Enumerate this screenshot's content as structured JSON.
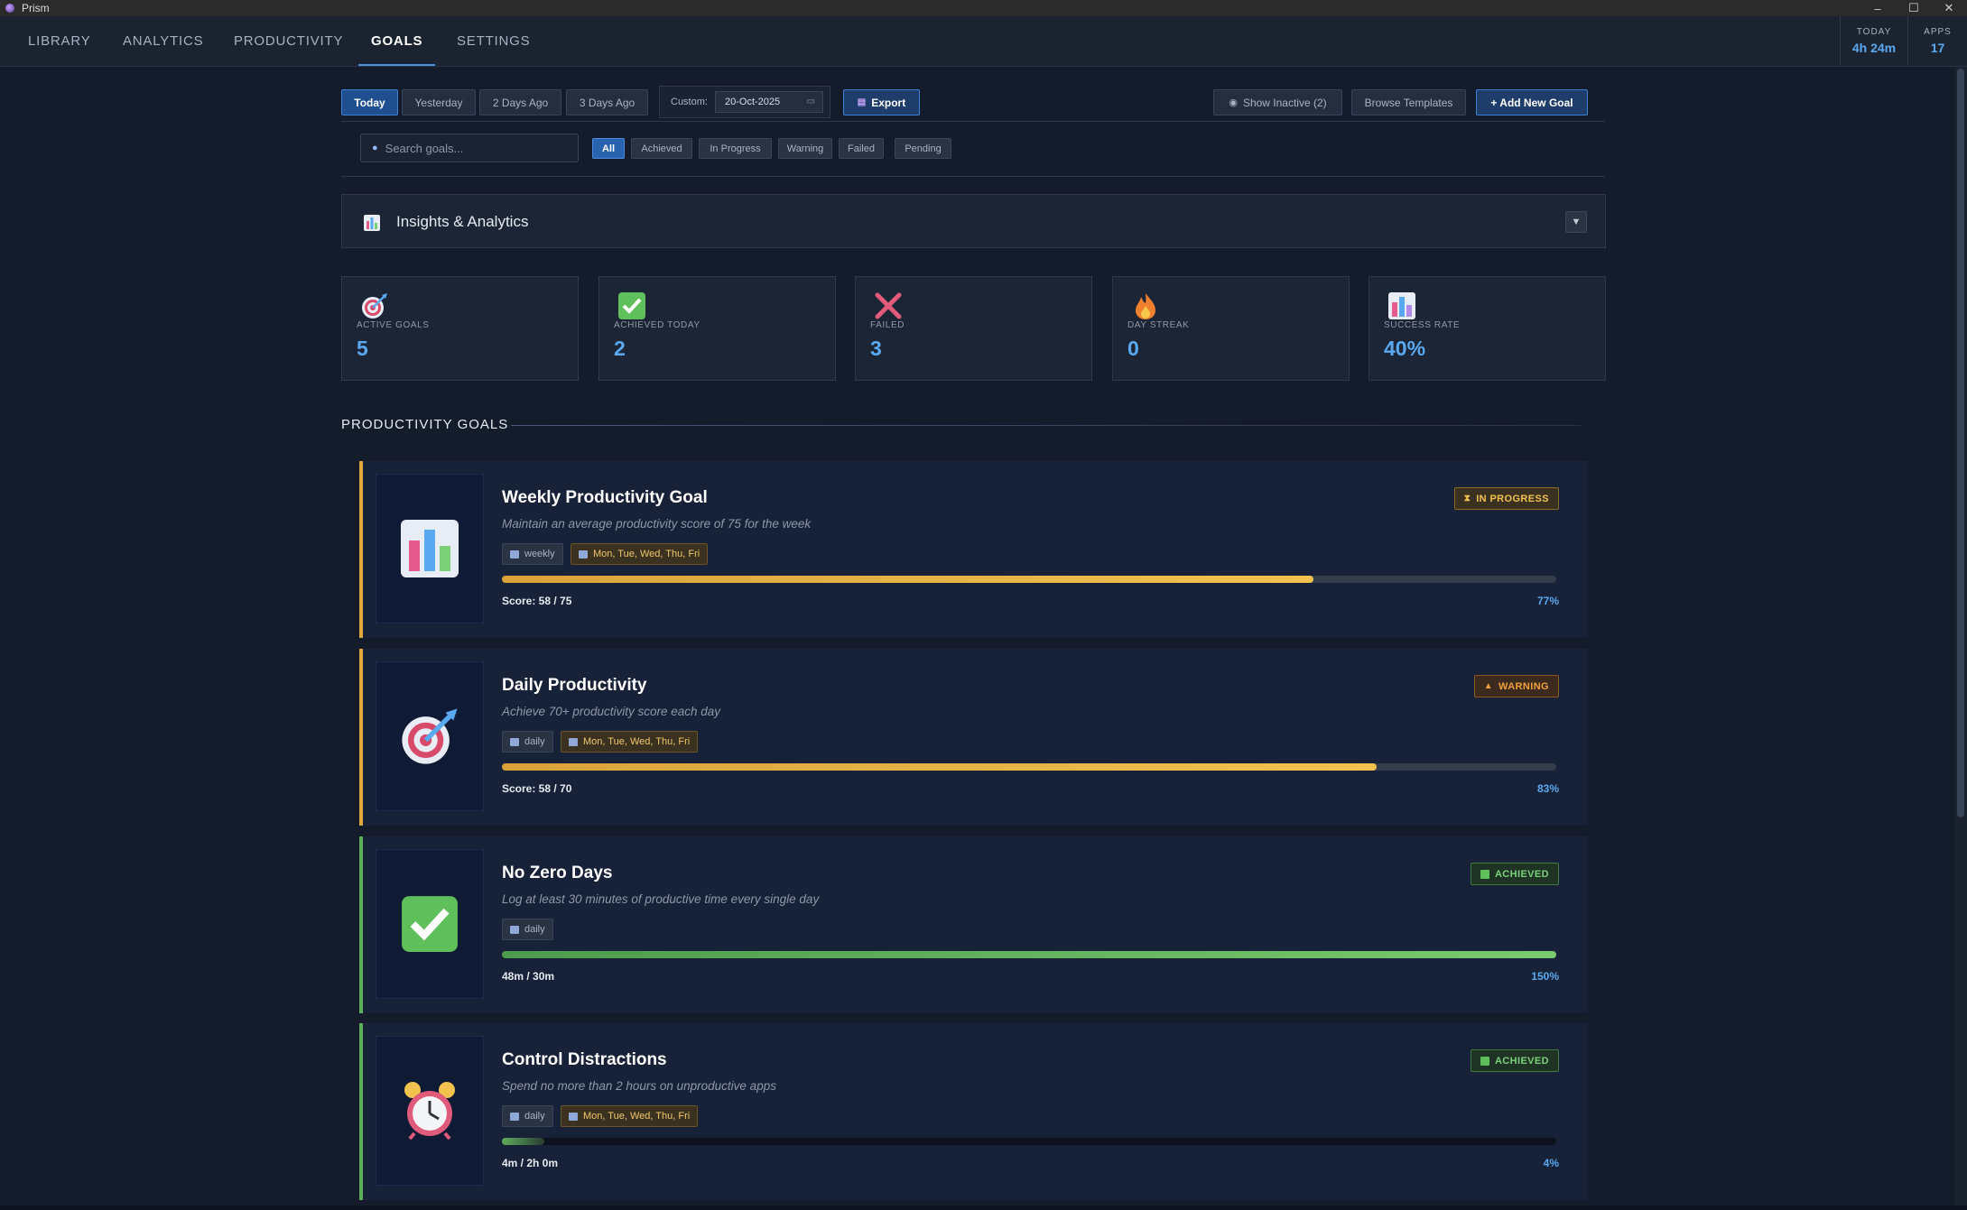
{
  "window": {
    "title": "Prism",
    "controls": [
      "–",
      "☐",
      "✕"
    ]
  },
  "nav": {
    "tabs": [
      {
        "label": "LIBRARY"
      },
      {
        "label": "ANALYTICS"
      },
      {
        "label": "PRODUCTIVITY"
      },
      {
        "label": "GOALS",
        "active": true
      },
      {
        "label": "SETTINGS"
      }
    ],
    "stats": [
      {
        "label": "TODAY",
        "value": "4h 24m"
      },
      {
        "label": "APPS",
        "value": "17"
      }
    ]
  },
  "toolbar": {
    "date_buttons": [
      "Today",
      "Yesterday",
      "2 Days Ago",
      "3 Days Ago"
    ],
    "active_date": "Today",
    "custom_label": "Custom:",
    "custom_date": "20-Oct-2025",
    "export_label": "Export",
    "show_inactive_label": "Show Inactive (2)",
    "browse_templates_label": "Browse Templates",
    "add_goal_label": "+ Add New Goal"
  },
  "filters": {
    "search_placeholder": "Search goals...",
    "chips": [
      "All",
      "Achieved",
      "In Progress",
      "Warning",
      "Failed",
      "Pending"
    ],
    "active_chip": "All"
  },
  "insights": {
    "title": "Insights & Analytics",
    "toggle": "▼"
  },
  "stats": [
    {
      "label": "ACTIVE GOALS",
      "value": "5",
      "icon": "target-icon"
    },
    {
      "label": "ACHIEVED TODAY",
      "value": "2",
      "icon": "checkmark-icon"
    },
    {
      "label": "FAILED",
      "value": "3",
      "icon": "cross-icon"
    },
    {
      "label": "DAY STREAK",
      "value": "0",
      "icon": "fire-icon"
    },
    {
      "label": "SUCCESS RATE",
      "value": "40%",
      "icon": "bar-chart-icon"
    }
  ],
  "section": {
    "title": "PRODUCTIVITY GOALS"
  },
  "goals": [
    {
      "title": "Weekly Productivity Goal",
      "description": "Maintain an average productivity score of 75 for the week",
      "frequency": "weekly",
      "days": "Mon, Tue, Wed, Thu, Fri",
      "status": "IN PROGRESS",
      "progress_fraction": 0.77,
      "score": "Score: 58 / 75",
      "percent": "77%",
      "icon": "bar-chart-icon",
      "accent": "#e0a83a"
    },
    {
      "title": "Daily Productivity",
      "description": "Achieve 70+ productivity score each day",
      "frequency": "daily",
      "days": "Mon, Tue, Wed, Thu, Fri",
      "status": "WARNING",
      "progress_fraction": 0.83,
      "score": "Score: 58 / 70",
      "percent": "83%",
      "icon": "target-icon",
      "accent": "#e0a83a"
    },
    {
      "title": "No Zero Days",
      "description": "Log at least 30 minutes of productive time every single day",
      "frequency": "daily",
      "status": "ACHIEVED",
      "progress_fraction": 1.0,
      "score": "48m / 30m",
      "percent": "150%",
      "icon": "checkmark-icon",
      "accent": "#5fae5a"
    },
    {
      "title": "Control Distractions",
      "description": "Spend no more than 2 hours on unproductive apps",
      "frequency": "daily",
      "days": "Mon, Tue, Wed, Thu, Fri",
      "status": "ACHIEVED",
      "progress_fraction": 0.04,
      "score": "4m / 2h 0m",
      "percent": "4%",
      "icon": "alarm-clock-icon",
      "accent": "#5fae5a"
    }
  ],
  "colors": {
    "accent_blue": "#5aa9f0",
    "warning_amber": "#e0a83a",
    "success_green": "#5fae5a"
  }
}
